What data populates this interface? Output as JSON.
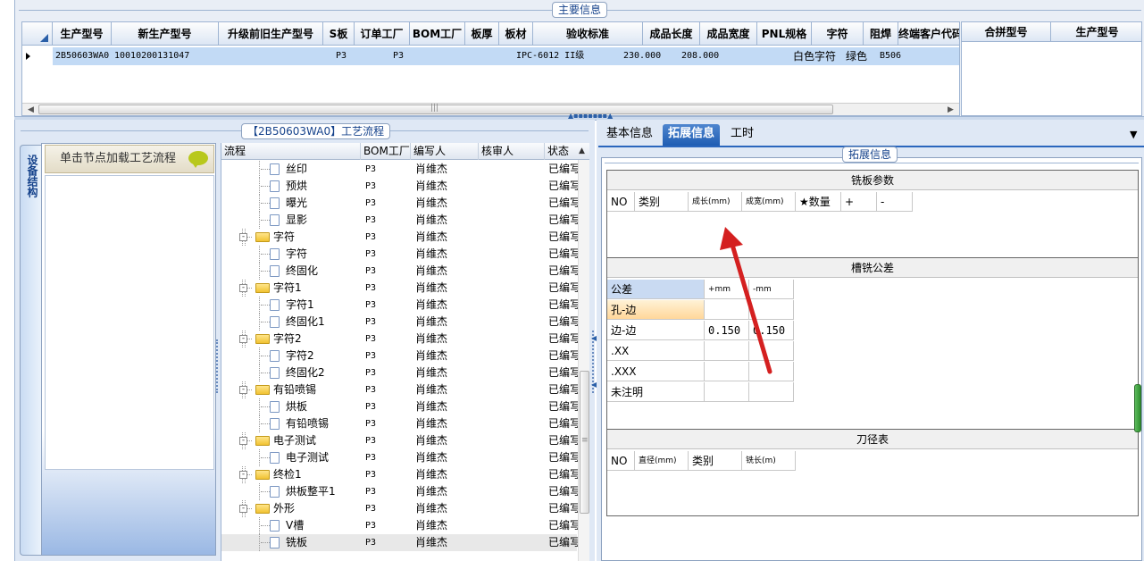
{
  "main_info": {
    "caption": "主要信息",
    "columns": [
      "生产型号",
      "新生产型号",
      "升级前旧生产型号",
      "S板",
      "订单工厂",
      "BOM工厂",
      "板厚",
      "板材",
      "验收标准",
      "成品长度",
      "成品宽度",
      "PNL规格",
      "字符",
      "阻焊",
      "终端客户代码"
    ],
    "row": {
      "prod_model": "2B50603WA0",
      "new_model": "10010200131047",
      "old_model": "",
      "s_board": "",
      "order_factory": "P3",
      "bom_factory": "P3",
      "thickness": "",
      "material": "",
      "standard": "IPC-6012 II级",
      "length": "230.000",
      "width": "208.000",
      "pnl": "",
      "char": "白色字符",
      "mask": "绿色",
      "customer": "B506"
    },
    "side_columns": [
      "合拼型号",
      "生产型号"
    ]
  },
  "process": {
    "caption": "【2B50603WA0】工艺流程",
    "side_tab": "设备结构",
    "load_button": "单击节点加载工艺流程",
    "columns": [
      "流程",
      "BOM工厂",
      "编写人",
      "核审人",
      "状态"
    ],
    "rows": [
      {
        "name": "丝印",
        "kind": "doc",
        "level": 2,
        "bom": "P3",
        "author": "肖维杰",
        "reviewer": "",
        "status": "已编写"
      },
      {
        "name": "预烘",
        "kind": "doc",
        "level": 2,
        "bom": "P3",
        "author": "肖维杰",
        "reviewer": "",
        "status": "已编写"
      },
      {
        "name": "曝光",
        "kind": "doc",
        "level": 2,
        "bom": "P3",
        "author": "肖维杰",
        "reviewer": "",
        "status": "已编写"
      },
      {
        "name": "显影",
        "kind": "doc",
        "level": 2,
        "bom": "P3",
        "author": "肖维杰",
        "reviewer": "",
        "status": "已编写"
      },
      {
        "name": "字符",
        "kind": "folder",
        "level": 1,
        "bom": "P3",
        "author": "肖维杰",
        "reviewer": "",
        "status": "已编写"
      },
      {
        "name": "字符",
        "kind": "doc",
        "level": 2,
        "bom": "P3",
        "author": "肖维杰",
        "reviewer": "",
        "status": "已编写"
      },
      {
        "name": "终固化",
        "kind": "doc",
        "level": 2,
        "bom": "P3",
        "author": "肖维杰",
        "reviewer": "",
        "status": "已编写"
      },
      {
        "name": "字符1",
        "kind": "folder",
        "level": 1,
        "bom": "P3",
        "author": "肖维杰",
        "reviewer": "",
        "status": "已编写"
      },
      {
        "name": "字符1",
        "kind": "doc",
        "level": 2,
        "bom": "P3",
        "author": "肖维杰",
        "reviewer": "",
        "status": "已编写"
      },
      {
        "name": "终固化1",
        "kind": "doc",
        "level": 2,
        "bom": "P3",
        "author": "肖维杰",
        "reviewer": "",
        "status": "已编写"
      },
      {
        "name": "字符2",
        "kind": "folder",
        "level": 1,
        "bom": "P3",
        "author": "肖维杰",
        "reviewer": "",
        "status": "已编写"
      },
      {
        "name": "字符2",
        "kind": "doc",
        "level": 2,
        "bom": "P3",
        "author": "肖维杰",
        "reviewer": "",
        "status": "已编写"
      },
      {
        "name": "终固化2",
        "kind": "doc",
        "level": 2,
        "bom": "P3",
        "author": "肖维杰",
        "reviewer": "",
        "status": "已编写"
      },
      {
        "name": "有铅喷锡",
        "kind": "folder",
        "level": 1,
        "bom": "P3",
        "author": "肖维杰",
        "reviewer": "",
        "status": "已编写"
      },
      {
        "name": "烘板",
        "kind": "doc",
        "level": 2,
        "bom": "P3",
        "author": "肖维杰",
        "reviewer": "",
        "status": "已编写"
      },
      {
        "name": "有铅喷锡",
        "kind": "doc",
        "level": 2,
        "bom": "P3",
        "author": "肖维杰",
        "reviewer": "",
        "status": "已编写"
      },
      {
        "name": "电子测试",
        "kind": "folder",
        "level": 1,
        "bom": "P3",
        "author": "肖维杰",
        "reviewer": "",
        "status": "已编写"
      },
      {
        "name": "电子测试",
        "kind": "doc",
        "level": 2,
        "bom": "P3",
        "author": "肖维杰",
        "reviewer": "",
        "status": "已编写"
      },
      {
        "name": "终检1",
        "kind": "folder",
        "level": 1,
        "bom": "P3",
        "author": "肖维杰",
        "reviewer": "",
        "status": "已编写"
      },
      {
        "name": "烘板整平1",
        "kind": "doc",
        "level": 2,
        "bom": "P3",
        "author": "肖维杰",
        "reviewer": "",
        "status": "已编写"
      },
      {
        "name": "外形",
        "kind": "folder",
        "level": 1,
        "bom": "P3",
        "author": "肖维杰",
        "reviewer": "",
        "status": "已编写"
      },
      {
        "name": "V槽",
        "kind": "doc",
        "level": 2,
        "bom": "P3",
        "author": "肖维杰",
        "reviewer": "",
        "status": "已编写"
      },
      {
        "name": "铣板",
        "kind": "doc",
        "level": 2,
        "bom": "P3",
        "author": "肖维杰",
        "reviewer": "",
        "status": "已编写",
        "selected": true
      }
    ]
  },
  "detail": {
    "tabs": [
      "基本信息",
      "拓展信息",
      "工时"
    ],
    "active_tab": 1,
    "ext_caption": "拓展信息",
    "milling": {
      "title": "铣板参数",
      "columns": [
        "NO",
        "类别",
        "成长(mm)",
        "成宽(mm)",
        "★数量",
        "+",
        "-"
      ]
    },
    "tolerance": {
      "title": "槽铣公差",
      "columns": [
        "公差",
        "+mm",
        "-mm"
      ],
      "rows": [
        {
          "label": "孔-边",
          "plus": "",
          "minus": ""
        },
        {
          "label": "边-边",
          "plus": "0.150",
          "minus": "0.150"
        },
        {
          "label": ".XX",
          "plus": "",
          "minus": ""
        },
        {
          "label": ".XXX",
          "plus": "",
          "minus": ""
        },
        {
          "label": "未注明",
          "plus": "",
          "minus": ""
        }
      ]
    },
    "tools": {
      "title": "刀径表",
      "columns": [
        "NO",
        "直径(mm)",
        "类别",
        "铣长(m)"
      ]
    }
  },
  "colors": {
    "annotation_arrow": "#d42020",
    "selected_row": "#c2daf5",
    "active_tab": "#2a66bd",
    "highlight_cell": "#ffd79a"
  }
}
